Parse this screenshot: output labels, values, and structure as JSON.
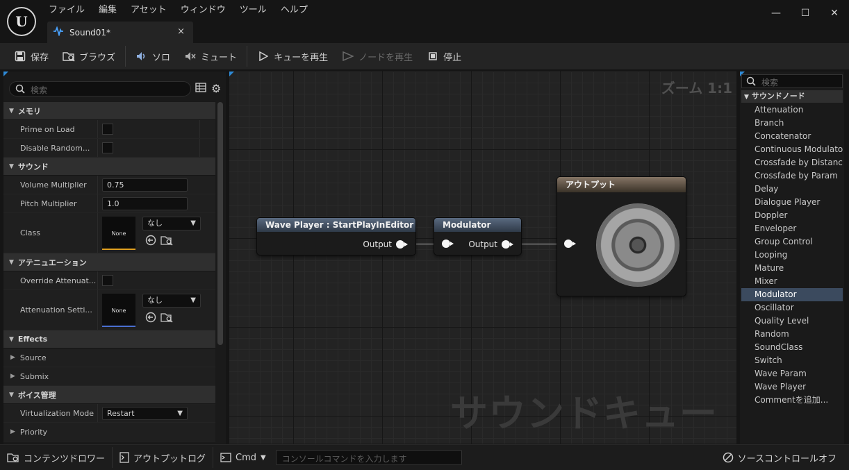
{
  "menu": [
    "ファイル",
    "編集",
    "アセット",
    "ウィンドウ",
    "ツール",
    "ヘルプ"
  ],
  "tab": {
    "title": "Sound01*",
    "close": "×"
  },
  "window_controls": {
    "minimize": "—",
    "maximize": "☐",
    "close": "✕"
  },
  "toolbar": {
    "save": "保存",
    "browse": "ブラウズ",
    "solo": "ソロ",
    "mute": "ミュート",
    "play_cue": "キューを再生",
    "play_node": "ノードを再生",
    "stop": "停止"
  },
  "details": {
    "search_placeholder": "検索",
    "sections": {
      "memory": "メモリ",
      "sound": "サウンド",
      "attenuation": "アテニュエーション",
      "effects": "Effects",
      "voice": "ボイス管理"
    },
    "props": {
      "prime_on_load": "Prime on Load",
      "disable_random": "Disable Random...",
      "volume_multiplier": "Volume Multiplier",
      "volume_value": "0.75",
      "pitch_multiplier": "Pitch Multiplier",
      "pitch_value": "1.0",
      "class": "Class",
      "class_thumb": "None",
      "class_combo": "なし",
      "override_attenuation": "Override Attenuat...",
      "attenuation_settings": "Attenuation Setti...",
      "attenuation_thumb": "None",
      "attenuation_combo": "なし",
      "source": "Source",
      "submix": "Submix",
      "virtualization_mode": "Virtualization Mode",
      "virtualization_value": "Restart",
      "priority": "Priority"
    }
  },
  "graph": {
    "zoom": "ズーム 1:1",
    "watermark": "サウンドキュー",
    "nodes": {
      "wave_player": {
        "title": "Wave Player : StartPlayInEditor",
        "output": "Output"
      },
      "modulator": {
        "title": "Modulator",
        "output": "Output"
      },
      "output": {
        "title": "アウトプット"
      }
    }
  },
  "palette": {
    "search_placeholder": "検索",
    "category": "サウンドノード",
    "items": [
      "Attenuation",
      "Branch",
      "Concatenator",
      "Continuous Modulator",
      "Crossfade by Distance",
      "Crossfade by Param",
      "Delay",
      "Dialogue Player",
      "Doppler",
      "Enveloper",
      "Group Control",
      "Looping",
      "Mature",
      "Mixer",
      "Modulator",
      "Oscillator",
      "Quality Level",
      "Random",
      "SoundClass",
      "Switch",
      "Wave Param",
      "Wave Player",
      "Commentを追加..."
    ],
    "selected": "Modulator"
  },
  "bottom": {
    "content_drawer": "コンテンツドロワー",
    "output_log": "アウトプットログ",
    "cmd": "Cmd",
    "console_placeholder": "コンソールコマンドを入力します",
    "source_control": "ソースコントロールオフ"
  },
  "colors": {
    "accent_blue": "#2f8bd8",
    "class_thumb_bar": "#e0a020",
    "attenuation_thumb_bar": "#4a6fd0",
    "selected_item": "#3b4a5e"
  }
}
